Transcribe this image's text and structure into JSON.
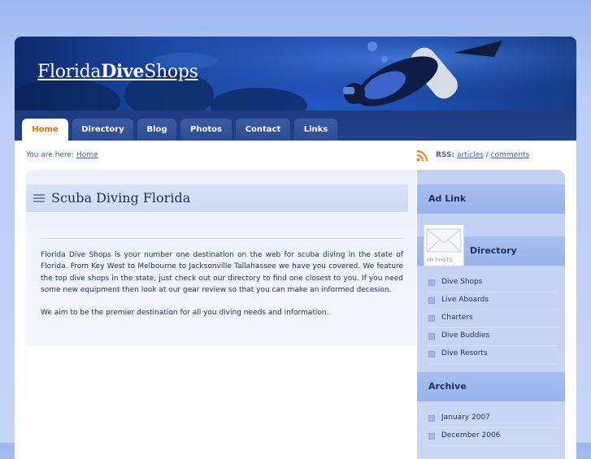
{
  "header": {
    "title_part1": "Florida",
    "title_part2": "Dive",
    "title_part3": "Shops"
  },
  "nav": {
    "tabs": [
      {
        "label": "Home",
        "active": true
      },
      {
        "label": "Directory",
        "active": false
      },
      {
        "label": "Blog",
        "active": false
      },
      {
        "label": "Photos",
        "active": false
      },
      {
        "label": "Contact",
        "active": false
      },
      {
        "label": "Links",
        "active": false
      }
    ]
  },
  "breadcrumb": {
    "prefix": "You are here:",
    "home": "Home"
  },
  "rss": {
    "label": "RSS:",
    "articles": "articles",
    "separator": "/",
    "comments": "comments"
  },
  "main": {
    "title": "Scuba Diving Florida",
    "paragraph1": "Florida Dive Shops is your number one destination on the web for scuba diving in the state of Florida.  From Key West to Melbourne to Jacksonville Tallahassee we have you covered.  We feature the top dive shops in the state, just check out our directory to find one closest to you.  If you need some new equipment then look at our gear review so that you can make an informed decesion.",
    "paragraph2": "We aim to be the premier destination for all you diving needs and information."
  },
  "sidebar": {
    "ad_heading": "Ad Link",
    "photo_caption": "MY PHOTO",
    "directory_heading": "Directory",
    "directory_items": [
      "Dive Shops",
      "Live Aboards",
      "Charters",
      "Dive Buddies",
      "Dive Resorts"
    ],
    "archive_heading": "Archive",
    "archive_items": [
      "January 2007",
      "December 2006"
    ]
  },
  "colors": {
    "active_tab_text": "#e26d00",
    "nav_bg": "#1d3a80",
    "text": "#1d2d5e",
    "rss_orange": "#f08a24"
  }
}
